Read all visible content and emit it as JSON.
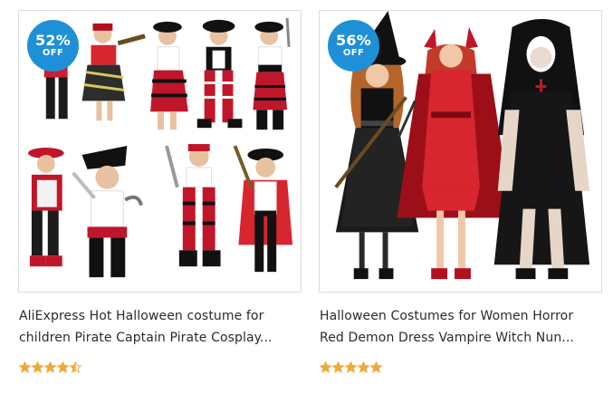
{
  "accent": "#1e90d8",
  "star_color": "#f2a93b",
  "products": [
    {
      "discount_pct": "52%",
      "discount_off": "OFF",
      "title_line1": "AliExpress Hot Halloween costume for",
      "title_line2": "children Pirate Captain Pirate Cosplay...",
      "rating": 4.5,
      "image_icon": "kids-pirate-costumes-image"
    },
    {
      "discount_pct": "56%",
      "discount_off": "OFF",
      "title_line1": "Halloween Costumes for Women Horror",
      "title_line2": "Red Demon Dress Vampire Witch Nun...",
      "rating": 5,
      "image_icon": "women-horror-costumes-image"
    }
  ]
}
